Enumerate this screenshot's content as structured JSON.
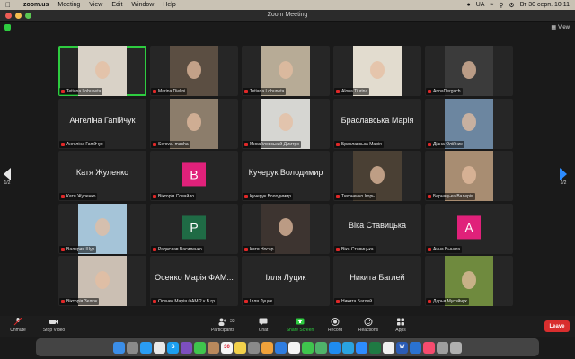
{
  "menubar": {
    "app": "zoom.us",
    "items": [
      "Meeting",
      "View",
      "Edit",
      "Window",
      "Help"
    ],
    "lang": "UA",
    "datetime": "Вт 30 серп.  10:11"
  },
  "window": {
    "title": "Zoom Meeting",
    "view_label": "View"
  },
  "pager": {
    "left": "1/2",
    "right": "1/2"
  },
  "tiles": [
    {
      "name": "Tetiana Lobuneta",
      "big": "",
      "kind": "photo",
      "bg": "#d9d2c7",
      "active": true
    },
    {
      "name": "Marina Dielini",
      "big": "",
      "kind": "photo",
      "bg": "#5b4e42"
    },
    {
      "name": "Tetiana Lobuneta",
      "big": "",
      "kind": "photo",
      "bg": "#b7ab96"
    },
    {
      "name": "Alona Tiurina",
      "big": "",
      "kind": "photo",
      "bg": "#e2dccf"
    },
    {
      "name": "AnnaDergach",
      "big": "",
      "kind": "photo",
      "bg": "#3b3b3b"
    },
    {
      "name": "Ангеліна Гапійчук",
      "big": "Ангеліна Гапійчук",
      "kind": "name"
    },
    {
      "name": "Serova. masha",
      "big": "",
      "kind": "photo",
      "bg": "#8c7d6b"
    },
    {
      "name": "Михайловський Дмитро",
      "big": "",
      "kind": "photo",
      "bg": "#d6d6d2"
    },
    {
      "name": "Браславська Марія",
      "big": "Браславська Марія",
      "kind": "name"
    },
    {
      "name": "Діана Олійник",
      "big": "",
      "kind": "photo",
      "bg": "#6c86a0"
    },
    {
      "name": "Катя Жуленко",
      "big": "Катя Жуленко",
      "kind": "name"
    },
    {
      "name": "Вікторія Совайло",
      "big": "",
      "kind": "avatar",
      "letter": "В",
      "color": "#e0217a"
    },
    {
      "name": "Кучерук Володимир",
      "big": "Кучерук Володимир",
      "kind": "name"
    },
    {
      "name": "Тихоненко Ігорь",
      "big": "",
      "kind": "photo",
      "bg": "#4a4034"
    },
    {
      "name": "Бернацька Валерія",
      "big": "",
      "kind": "photo",
      "bg": "#a88d72"
    },
    {
      "name": "Валерия Шур",
      "big": "",
      "kind": "photo",
      "bg": "#a5c4d8"
    },
    {
      "name": "Радислав Василенко",
      "big": "",
      "kind": "avatar",
      "letter": "Р",
      "color": "#1f6b45"
    },
    {
      "name": "Катя Носар",
      "big": "",
      "kind": "photo",
      "bg": "#3d3430"
    },
    {
      "name": "Віка Ставицька",
      "big": "Віка Ставицька",
      "kind": "name"
    },
    {
      "name": "Анна Вынага",
      "big": "",
      "kind": "avatar",
      "letter": "А",
      "color": "#e0217a"
    },
    {
      "name": "Вікторія Зелюк",
      "big": "",
      "kind": "photo",
      "bg": "#cbbfb3"
    },
    {
      "name": "Осенко Марія ФАМ 2 к.В гр.",
      "big": "Осенко Марія ФАМ...",
      "kind": "name"
    },
    {
      "name": "Ілля Луцик",
      "big": "Ілля Луцик",
      "kind": "name"
    },
    {
      "name": "Никита Баглей",
      "big": "Никита Баглей",
      "kind": "name"
    },
    {
      "name": "Дарья Мусийчук",
      "big": "",
      "kind": "photo",
      "bg": "#6f8a3e"
    }
  ],
  "toolbar": {
    "unmute": "Unmute",
    "stop_video": "Stop Video",
    "participants": "Participants",
    "participants_count": "33",
    "chat": "Chat",
    "share": "Share Screen",
    "record": "Record",
    "reactions": "Reactions",
    "apps": "Apps",
    "leave": "Leave"
  },
  "dock": {
    "icons": [
      {
        "name": "finder-icon",
        "color": "#3b8ee8",
        "glyph": ""
      },
      {
        "name": "launchpad-icon",
        "color": "#8a8a8a",
        "glyph": ""
      },
      {
        "name": "safari-icon",
        "color": "#2a9df4",
        "glyph": ""
      },
      {
        "name": "chrome-icon",
        "color": "#e8e8e8",
        "glyph": ""
      },
      {
        "name": "skype-icon",
        "color": "#1c9ff0",
        "glyph": "S"
      },
      {
        "name": "viber-icon",
        "color": "#7d4fbf",
        "glyph": ""
      },
      {
        "name": "messages-icon",
        "color": "#3fc54d",
        "glyph": ""
      },
      {
        "name": "contacts-icon",
        "color": "#b9895c",
        "glyph": ""
      },
      {
        "name": "calendar-icon",
        "color": "#f5f5f5",
        "glyph": "30"
      },
      {
        "name": "notes-icon",
        "color": "#f2d14b",
        "glyph": ""
      },
      {
        "name": "settings-icon",
        "color": "#8a8a8a",
        "glyph": ""
      },
      {
        "name": "pages-icon",
        "color": "#f0a23b",
        "glyph": ""
      },
      {
        "name": "keynote-icon",
        "color": "#2f7de0",
        "glyph": ""
      },
      {
        "name": "photos-icon",
        "color": "#f5f5f5",
        "glyph": ""
      },
      {
        "name": "facetime-icon",
        "color": "#3fc54d",
        "glyph": ""
      },
      {
        "name": "maps-icon",
        "color": "#4fb36a",
        "glyph": ""
      },
      {
        "name": "appstore-icon",
        "color": "#1f8cf0",
        "glyph": ""
      },
      {
        "name": "telegram-icon",
        "color": "#2aa3e0",
        "glyph": ""
      },
      {
        "name": "zoom-icon",
        "color": "#2d8cff",
        "glyph": ""
      },
      {
        "name": "excel-icon",
        "color": "#1f7a43",
        "glyph": ""
      },
      {
        "name": "music-icon",
        "color": "#f0f0f0",
        "glyph": ""
      },
      {
        "name": "word-icon",
        "color": "#2b5cb5",
        "glyph": "W"
      },
      {
        "name": "outlook-icon",
        "color": "#2a72d0",
        "glyph": ""
      },
      {
        "name": "itunes-icon",
        "color": "#f64b6e",
        "glyph": ""
      },
      {
        "name": "preview-icon",
        "color": "#9e9e9e",
        "glyph": ""
      },
      {
        "name": "trash-icon",
        "color": "#b0b0b0",
        "glyph": ""
      }
    ]
  }
}
